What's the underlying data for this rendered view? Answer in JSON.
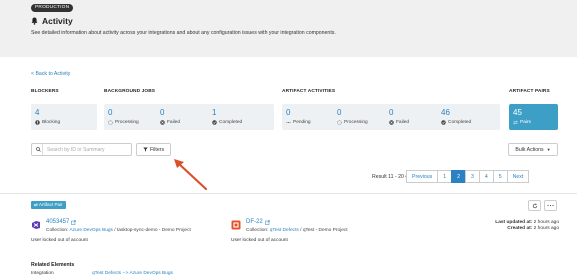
{
  "header": {
    "env_badge": "PRODUCTION",
    "title": "Activity",
    "description": "See detailed information about activity across your integrations and about any configuration issues with your integration components."
  },
  "nav": {
    "back_label": "< Back to Activity"
  },
  "stats": {
    "groups": {
      "blockers": "BLOCKERS",
      "background_jobs": "BACKGROUND JOBS",
      "artifact_activities": "ARTIFACT ACTIVITIES",
      "artifact_pairs": "ARTIFACT PAIRS"
    },
    "blocking": {
      "value": "4",
      "label": "Blocking"
    },
    "jobs_processing": {
      "value": "0",
      "label": "Processing"
    },
    "jobs_failed": {
      "value": "0",
      "label": "Failed"
    },
    "jobs_completed": {
      "value": "1",
      "label": "Completed"
    },
    "act_pending": {
      "value": "0",
      "label": "Pending"
    },
    "act_processing": {
      "value": "0",
      "label": "Processing"
    },
    "act_failed": {
      "value": "0",
      "label": "Failed"
    },
    "act_completed": {
      "value": "46",
      "label": "Completed"
    },
    "pairs": {
      "value": "45",
      "label": "Pairs"
    }
  },
  "toolbar": {
    "search_placeholder": "Search by ID or Summary",
    "filters_label": "Filters",
    "bulk_label": "Bulk Actions"
  },
  "pagination": {
    "result_text": "Result 11 - 20 of 45",
    "previous": "Previous",
    "pages": [
      "1",
      "2",
      "3",
      "4",
      "5"
    ],
    "current_page": "2",
    "next": "Next"
  },
  "pair": {
    "tag": "Artifact Pair",
    "left": {
      "id": "4053457",
      "collection_label": "Collection:",
      "collection_link": "Azure DevOps Bugs",
      "collection_rest": "/ tasktop-sync-demo - Demo Project",
      "description": "User locked out of account"
    },
    "right": {
      "id": "DF-22",
      "collection_label": "Collection:",
      "collection_link": "qTest Defects",
      "collection_rest": "/ qTest - Demo Project",
      "description": "User locked out of account"
    },
    "updated_label": "Last updated at:",
    "updated_value": "2 hours ago",
    "created_label": "Created at:",
    "created_value": "2 hours ago"
  },
  "related": {
    "title": "Related Elements",
    "integration_label": "Integration",
    "integration_value": "qTest Defects --> Azure DevOps Bugs"
  },
  "colors": {
    "accent": "#2a82c2",
    "pairs_card": "#3e9fc6",
    "annotation_arrow": "#d9512c",
    "header_bg": "#f0f0f0"
  }
}
